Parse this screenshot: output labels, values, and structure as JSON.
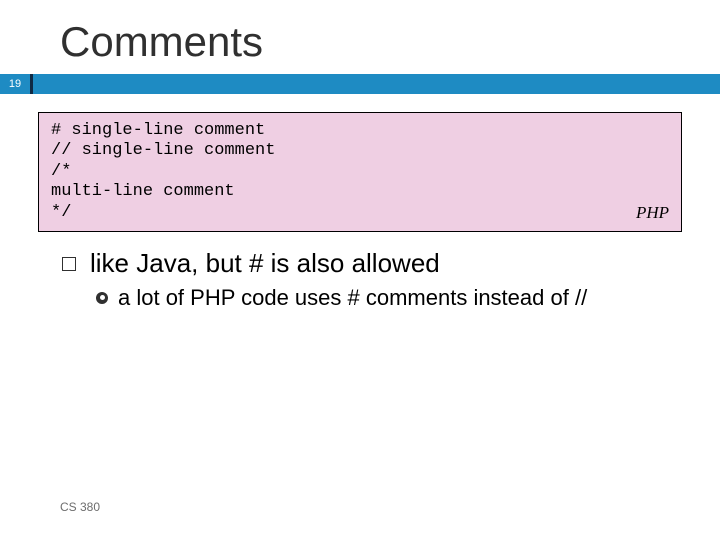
{
  "title": "Comments",
  "slide_number": "19",
  "code": {
    "lines": [
      "# single-line comment",
      "// single-line comment",
      "/*",
      "multi-line comment",
      "*/"
    ],
    "language_label": "PHP"
  },
  "bullets": {
    "level1": "like Java, but # is also allowed",
    "level2": "a lot of PHP code uses # comments instead of //"
  },
  "footer": "CS 380"
}
